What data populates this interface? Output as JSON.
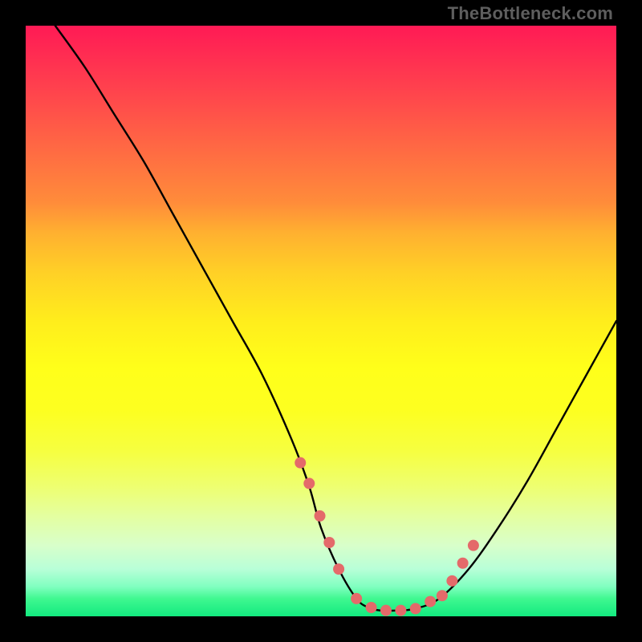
{
  "watermark": "TheBottleneck.com",
  "chart_data": {
    "type": "line",
    "title": "",
    "xlabel": "",
    "ylabel": "",
    "xlim": [
      0,
      100
    ],
    "ylim": [
      0,
      100
    ],
    "series": [
      {
        "name": "curve",
        "x": [
          5,
          10,
          15,
          20,
          25,
          30,
          35,
          40,
          45,
          48,
          50,
          53,
          56,
          58,
          60,
          63,
          66,
          70,
          75,
          80,
          85,
          90,
          95,
          100
        ],
        "y": [
          100,
          93,
          85,
          77,
          68,
          59,
          50,
          41,
          30,
          22,
          15,
          8,
          3,
          1.5,
          1,
          1,
          1.3,
          3,
          8,
          15,
          23,
          32,
          41,
          50
        ]
      }
    ],
    "markers": {
      "name": "highlight-dots",
      "color": "#e46a6a",
      "x": [
        46.5,
        48.0,
        49.8,
        51.4,
        53.0,
        56.0,
        58.5,
        61.0,
        63.5,
        66.0,
        68.5,
        70.5,
        72.2,
        74.0,
        75.8
      ],
      "y": [
        26.0,
        22.5,
        17.0,
        12.5,
        8.0,
        3.0,
        1.5,
        1.0,
        1.0,
        1.3,
        2.5,
        3.5,
        6.0,
        9.0,
        12.0
      ]
    }
  }
}
